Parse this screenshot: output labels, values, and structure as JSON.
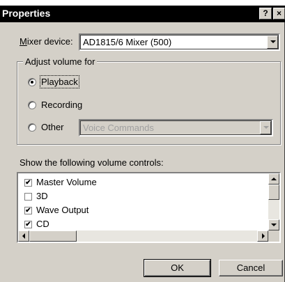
{
  "window": {
    "title": "Properties",
    "help_button": "?",
    "close_button": "×"
  },
  "mixer": {
    "label_accel": "M",
    "label_rest": "ixer device:",
    "value": "AD1815/6 Mixer (500)"
  },
  "adjust_group": {
    "title": "Adjust volume for",
    "options": [
      {
        "label": "Playback",
        "checked": true
      },
      {
        "label": "Recording",
        "checked": false
      },
      {
        "label": "Other",
        "checked": false
      }
    ],
    "other_combo_value": "Voice Commands"
  },
  "controls_list": {
    "label": "Show the following volume controls:",
    "items": [
      {
        "label": "Master Volume",
        "checked": true
      },
      {
        "label": "3D",
        "checked": false
      },
      {
        "label": "Wave Output",
        "checked": true
      },
      {
        "label": "CD",
        "checked": true
      }
    ]
  },
  "buttons": {
    "ok": "OK",
    "cancel": "Cancel"
  },
  "icons": {
    "check_glyph": "✔"
  }
}
